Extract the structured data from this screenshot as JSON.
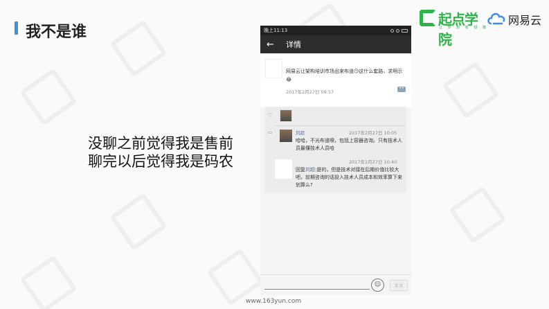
{
  "slide": {
    "title": "我不是谁",
    "quote_line1": "没聊之前觉得我是售前",
    "quote_line2": "聊完以后觉得我是码农",
    "footer_url": "www.163yun.com"
  },
  "brands": {
    "left_name": "起点学院",
    "left_sub": "让 梦 想 有 翅 膀",
    "right_name": "网易云",
    "accent_green": "#2fb24a",
    "accent_blue": "#3f8fe0"
  },
  "phone": {
    "status_time": "晚上11:13",
    "header_back": "←",
    "header_title": "详情",
    "post_text": "网易云让架构培训市场出来布道😏这什么套路，求明示😂",
    "post_time": "2017年2月27日 09:57",
    "comment1": {
      "name": "刘超",
      "time": "2017年2月27日 10:05",
      "text": "哈哈，不光布道噢，包括上容器咨询。只有技术人员最懂技术人员哈"
    },
    "comment2": {
      "time": "2017年2月27日 10:40",
      "reply_prefix": "回复",
      "reply_to": "刘超",
      "text": ":是的，但是技术对接在后期价值比较大吧，前期咨询的话投入技术人员成本和效率算下来划算么?"
    },
    "send_label": "发送"
  }
}
